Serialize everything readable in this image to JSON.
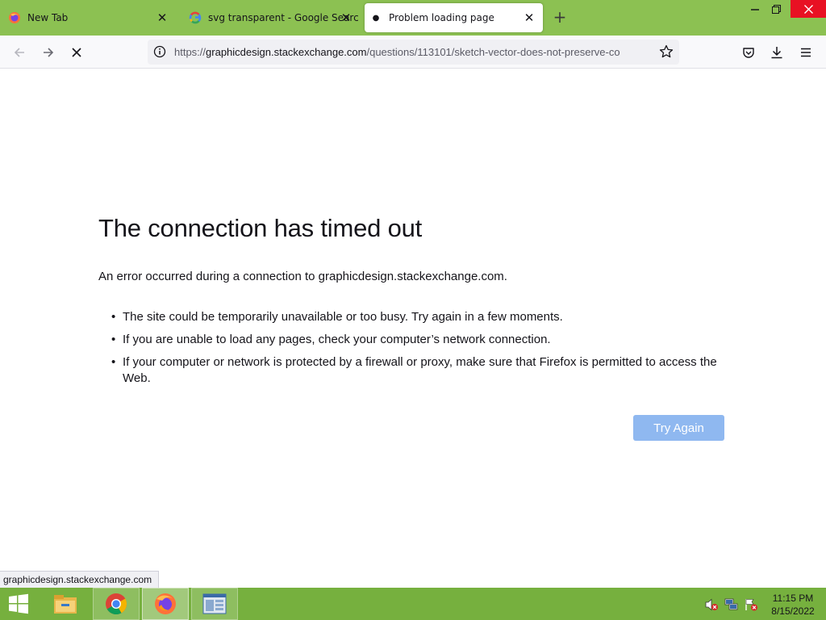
{
  "browser": {
    "tabs": [
      {
        "label": "New Tab",
        "icon": "firefox-icon",
        "active": false
      },
      {
        "label": "svg transparent - Google Search",
        "icon": "google-icon",
        "active": false
      },
      {
        "label": "Problem loading page",
        "icon": "loading-dot-icon",
        "active": true
      }
    ],
    "new_tab_symbol": "+",
    "url": {
      "prefix": "https://",
      "domain": "graphicdesign.stackexchange.com",
      "path": "/questions/113101/sketch-vector-does-not-preserve-co"
    }
  },
  "error_page": {
    "title": "The connection has timed out",
    "intro": "An error occurred during a connection to graphicdesign.stackexchange.com.",
    "items": [
      "The site could be temporarily unavailable or too busy. Try again in a few moments.",
      "If you are unable to load any pages, check your computer’s network connection.",
      "If your computer or network is protected by a firewall or proxy, make sure that Firefox is permitted to access the Web."
    ],
    "button_label": "Try Again"
  },
  "status_bar": {
    "text": "graphicdesign.stackexchange.com"
  },
  "taskbar": {
    "items": [
      "start-windows-icon",
      "file-explorer-icon",
      "chrome-icon",
      "firefox-icon",
      "app-window-icon"
    ],
    "clock": {
      "time": "11:15 PM",
      "date": "8/15/2022"
    }
  },
  "colors": {
    "tabstrip": "#8cc152",
    "taskbar": "#76b03e",
    "button": "#8fb8f0",
    "close_button": "#e81123"
  }
}
